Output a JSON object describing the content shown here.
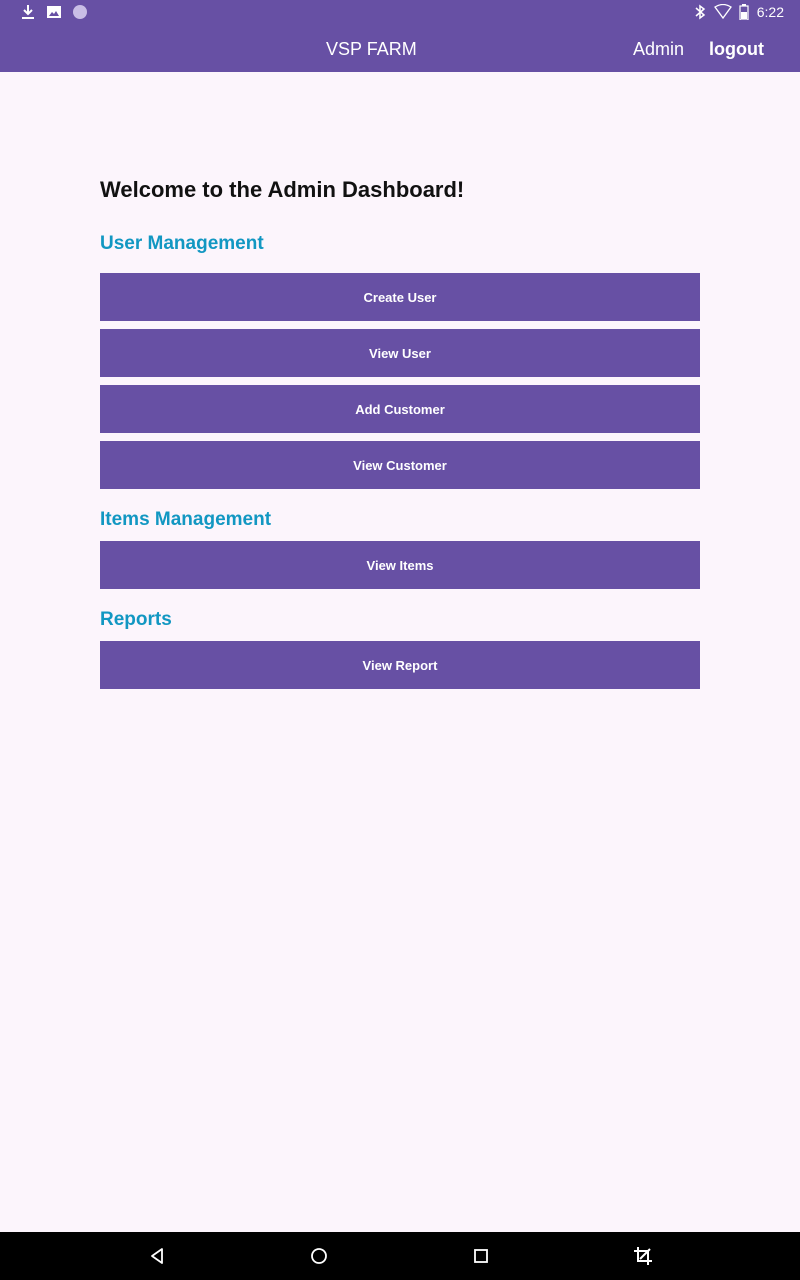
{
  "status_bar": {
    "time": "6:22",
    "left_icons": [
      "download-icon",
      "image-icon",
      "circle-notification-icon"
    ],
    "right_icons": [
      "bluetooth-icon",
      "wifi-icon",
      "battery-icon"
    ]
  },
  "app_bar": {
    "title": "VSP FARM",
    "user_label": "Admin",
    "logout_label": "logout"
  },
  "main": {
    "welcome": "Welcome to the Admin Dashboard!",
    "sections": [
      {
        "heading": "User Management",
        "buttons": [
          "Create User",
          "View User",
          "Add Customer",
          "View Customer"
        ]
      },
      {
        "heading": "Items Management",
        "buttons": [
          "View Items"
        ]
      },
      {
        "heading": "Reports",
        "buttons": [
          "View Report"
        ]
      }
    ]
  },
  "nav_bar": {
    "icons": [
      "back-icon",
      "home-icon",
      "recents-icon",
      "screenshot-crop-icon"
    ]
  },
  "colors": {
    "primary": "#6750A4",
    "section_heading": "#1297C2",
    "background": "#FCF5FC"
  }
}
